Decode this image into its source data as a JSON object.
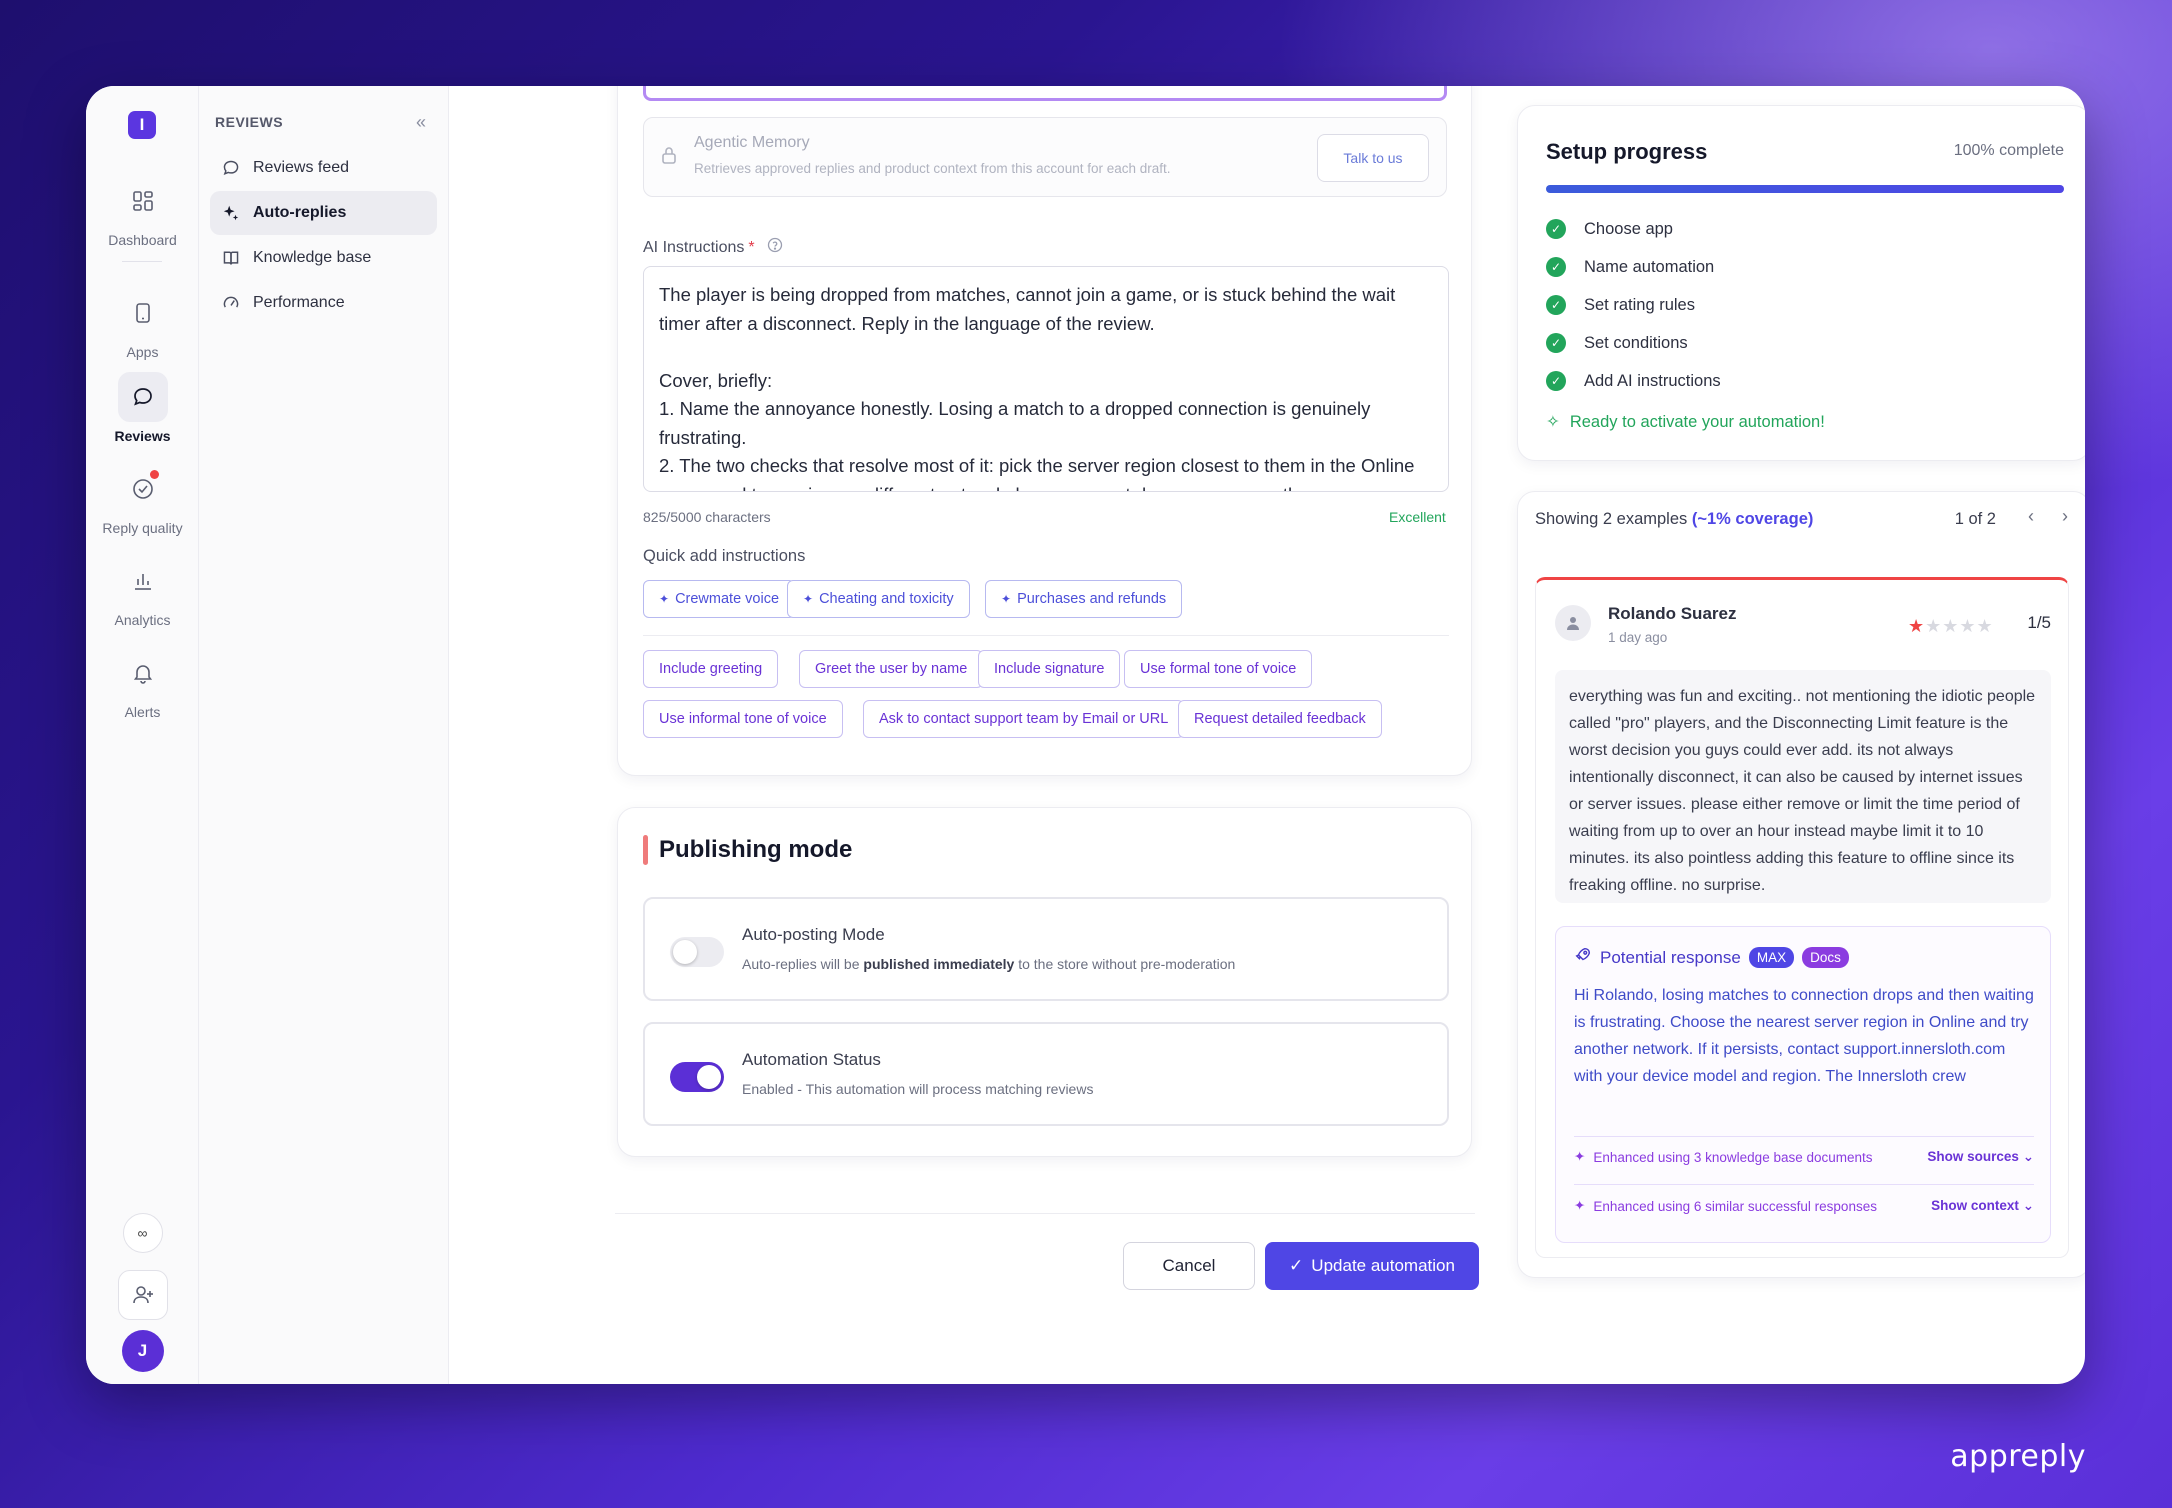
{
  "rail": {
    "logo": "I",
    "items": [
      {
        "label": "Dashboard",
        "icon": "grid-icon"
      },
      {
        "label": "Apps",
        "icon": "phone-icon"
      },
      {
        "label": "Reviews",
        "icon": "chat-bubble-icon"
      },
      {
        "label": "Reply quality",
        "icon": "check-circle-icon"
      },
      {
        "label": "Analytics",
        "icon": "bar-chart-icon"
      },
      {
        "label": "Alerts",
        "icon": "bell-icon"
      }
    ],
    "bottom": {
      "infinity": "∞",
      "avatar": "J"
    }
  },
  "sidebar": {
    "heading": "REVIEWS",
    "items": [
      {
        "label": "Reviews feed",
        "icon": "chat-bubble-icon"
      },
      {
        "label": "Auto-replies",
        "icon": "sparkle-icon"
      },
      {
        "label": "Knowledge base",
        "icon": "book-icon"
      },
      {
        "label": "Performance",
        "icon": "gauge-icon"
      }
    ]
  },
  "memory": {
    "title": "Agentic Memory",
    "description": "Retrieves approved replies and product context from this account for each draft.",
    "button": "Talk to us"
  },
  "instructions": {
    "label": "AI Instructions",
    "required_mark": "*",
    "text": "The player is being dropped from matches, cannot join a game, or is stuck behind the wait timer after a disconnect. Reply in the language of the review.\n\nCover, briefly:\n1. Name the annoyance honestly. Losing a match to a dropped connection is genuinely frustrating.\n2. The two checks that resolve most of it: pick the server region closest to them in the Online menu, and try again on a different network, because most drops we see are the",
    "counter": "825/5000 characters",
    "quality": "Excellent"
  },
  "quick_add": {
    "label": "Quick add instructions",
    "ai_chips": [
      "Crewmate voice",
      "Cheating and toxicity",
      "Purchases and refunds"
    ],
    "chips": [
      "Include greeting",
      "Greet the user by name",
      "Include signature",
      "Use formal tone of voice",
      "Use informal tone of voice",
      "Ask to contact support team by Email or URL",
      "Request detailed feedback"
    ]
  },
  "publishing": {
    "title": "Publishing mode",
    "auto_posting": {
      "title": "Auto-posting Mode",
      "desc_pre": "Auto-replies will be ",
      "desc_bold": "published immediately",
      "desc_post": " to the store without pre-moderation",
      "enabled": false
    },
    "status": {
      "title": "Automation Status",
      "desc": "Enabled - This automation will process matching reviews",
      "enabled": true
    }
  },
  "actions": {
    "cancel": "Cancel",
    "update": "Update automation"
  },
  "setup": {
    "title": "Setup progress",
    "percent_label": "100% complete",
    "progress": 1.0,
    "steps": [
      "Choose app",
      "Name automation",
      "Set rating rules",
      "Set conditions",
      "Add AI instructions"
    ],
    "ready": "Ready to activate your automation!"
  },
  "examples": {
    "prefix": "Showing 2 examples ",
    "coverage": "(~1% coverage)",
    "page": "1 of 2",
    "review": {
      "author": "Rolando Suarez",
      "time": "1 day ago",
      "stars": 1,
      "rating": "1/5",
      "body": "everything was fun and exciting.. not mentioning the idiotic people called \"pro\" players, and the Disconnecting Limit feature is the worst decision you guys could ever add. its not always intentionally disconnect, it can also be caused by internet issues or server issues. please either remove or limit the time period of waiting from up to over an hour instead maybe limit it to 10 minutes. its also pointless adding this feature to offline since its freaking offline. no surprise."
    },
    "response": {
      "title": "Potential response",
      "badges": [
        "MAX",
        "Docs"
      ],
      "text": "Hi Rolando, losing matches to connection drops and then waiting is frustrating. Choose the nearest server region in Online and try another network. If it persists, contact support.innersloth.com with your device model and region. The Innersloth crew",
      "enhanced_kb": "Enhanced using 3 knowledge base documents",
      "show_sources": "Show sources",
      "enhanced_sim": "Enhanced using 6 similar successful responses",
      "show_context": "Show context"
    }
  },
  "brand": "appreply"
}
